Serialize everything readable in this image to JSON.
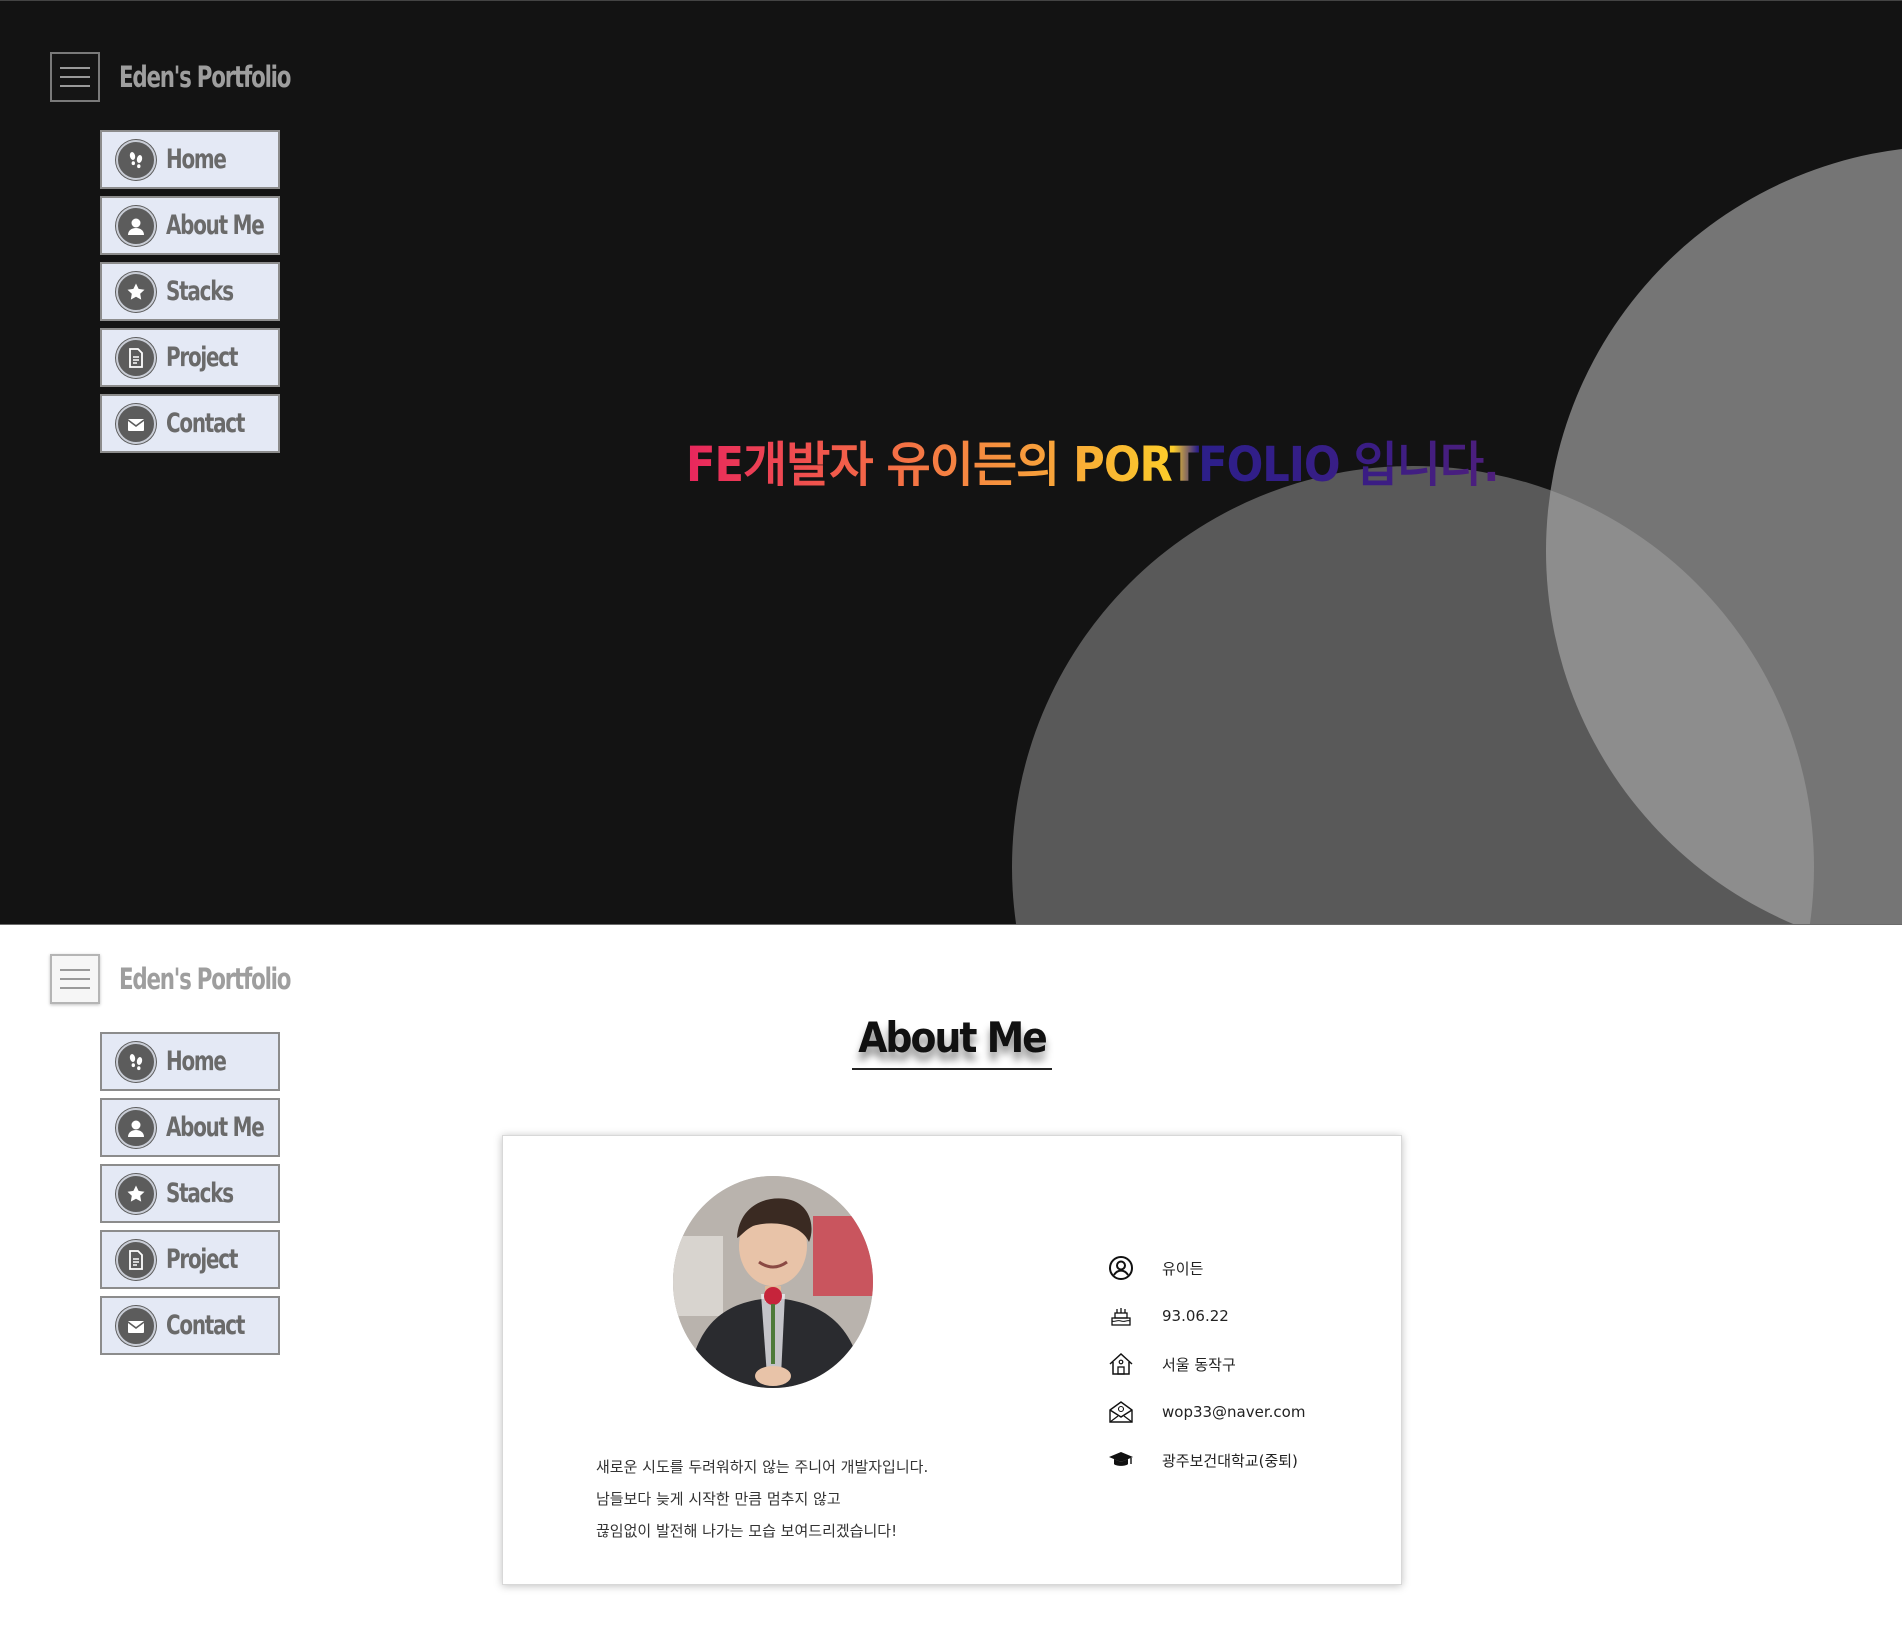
{
  "brand": {
    "title": "Eden's Portfolio"
  },
  "menu": {
    "items": [
      {
        "label": "Home",
        "icon": "footprints-icon"
      },
      {
        "label": "About Me",
        "icon": "user-icon"
      },
      {
        "label": "Stacks",
        "icon": "star-icon"
      },
      {
        "label": "Project",
        "icon": "document-icon"
      },
      {
        "label": "Contact",
        "icon": "mail-icon"
      }
    ]
  },
  "hero": {
    "headline": "FE개발자 유이든의 PORTFOLIO 입니다.",
    "colors": {
      "background": "#131313",
      "gradient_start": "#e8265d",
      "gradient_mid": "#fccd2a",
      "gradient_end": "#3b1d84"
    }
  },
  "about": {
    "title": "About Me",
    "intro": [
      "새로운 시도를 두려워하지 않는 주니어 개발자입니다.",
      "남들보다 늦게 시작한 만큼 멈추지 않고",
      "끊임없이 발전해 나가는 모습 보여드리겠습니다!"
    ],
    "info": [
      {
        "icon": "user-circle-icon",
        "text": "유이든"
      },
      {
        "icon": "birthday-cake-icon",
        "text": "93.06.22"
      },
      {
        "icon": "house-icon",
        "text": "서울 동작구"
      },
      {
        "icon": "envelope-icon",
        "text": "wop33@naver.com"
      },
      {
        "icon": "graduation-cap-icon",
        "text": "광주보건대학교(중퇴)"
      }
    ]
  },
  "colors": {
    "menu_bg": "#e4e9f5",
    "menu_border": "#8c8c8c",
    "icon_bg": "#5c5c5c"
  }
}
